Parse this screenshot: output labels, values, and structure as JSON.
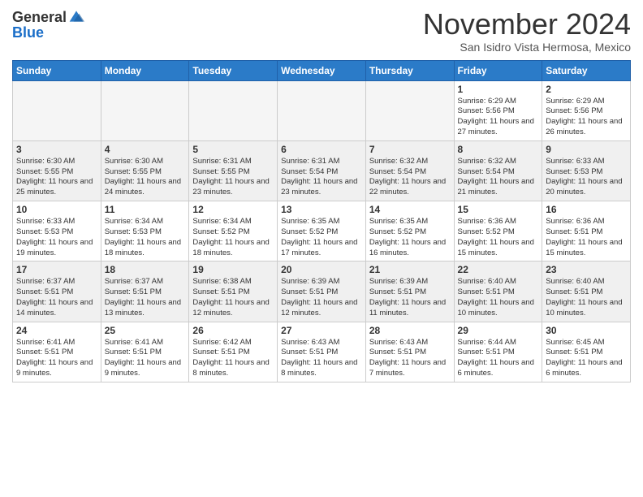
{
  "logo": {
    "general": "General",
    "blue": "Blue"
  },
  "header": {
    "month": "November 2024",
    "location": "San Isidro Vista Hermosa, Mexico"
  },
  "days_of_week": [
    "Sunday",
    "Monday",
    "Tuesday",
    "Wednesday",
    "Thursday",
    "Friday",
    "Saturday"
  ],
  "weeks": [
    [
      {
        "day": "",
        "empty": true
      },
      {
        "day": "",
        "empty": true
      },
      {
        "day": "",
        "empty": true
      },
      {
        "day": "",
        "empty": true
      },
      {
        "day": "",
        "empty": true
      },
      {
        "day": "1",
        "sunrise": "6:29 AM",
        "sunset": "5:56 PM",
        "daylight": "11 hours and 27 minutes."
      },
      {
        "day": "2",
        "sunrise": "6:29 AM",
        "sunset": "5:56 PM",
        "daylight": "11 hours and 26 minutes."
      }
    ],
    [
      {
        "day": "3",
        "sunrise": "6:30 AM",
        "sunset": "5:55 PM",
        "daylight": "11 hours and 25 minutes."
      },
      {
        "day": "4",
        "sunrise": "6:30 AM",
        "sunset": "5:55 PM",
        "daylight": "11 hours and 24 minutes."
      },
      {
        "day": "5",
        "sunrise": "6:31 AM",
        "sunset": "5:55 PM",
        "daylight": "11 hours and 23 minutes."
      },
      {
        "day": "6",
        "sunrise": "6:31 AM",
        "sunset": "5:54 PM",
        "daylight": "11 hours and 23 minutes."
      },
      {
        "day": "7",
        "sunrise": "6:32 AM",
        "sunset": "5:54 PM",
        "daylight": "11 hours and 22 minutes."
      },
      {
        "day": "8",
        "sunrise": "6:32 AM",
        "sunset": "5:54 PM",
        "daylight": "11 hours and 21 minutes."
      },
      {
        "day": "9",
        "sunrise": "6:33 AM",
        "sunset": "5:53 PM",
        "daylight": "11 hours and 20 minutes."
      }
    ],
    [
      {
        "day": "10",
        "sunrise": "6:33 AM",
        "sunset": "5:53 PM",
        "daylight": "11 hours and 19 minutes."
      },
      {
        "day": "11",
        "sunrise": "6:34 AM",
        "sunset": "5:53 PM",
        "daylight": "11 hours and 18 minutes."
      },
      {
        "day": "12",
        "sunrise": "6:34 AM",
        "sunset": "5:52 PM",
        "daylight": "11 hours and 18 minutes."
      },
      {
        "day": "13",
        "sunrise": "6:35 AM",
        "sunset": "5:52 PM",
        "daylight": "11 hours and 17 minutes."
      },
      {
        "day": "14",
        "sunrise": "6:35 AM",
        "sunset": "5:52 PM",
        "daylight": "11 hours and 16 minutes."
      },
      {
        "day": "15",
        "sunrise": "6:36 AM",
        "sunset": "5:52 PM",
        "daylight": "11 hours and 15 minutes."
      },
      {
        "day": "16",
        "sunrise": "6:36 AM",
        "sunset": "5:51 PM",
        "daylight": "11 hours and 15 minutes."
      }
    ],
    [
      {
        "day": "17",
        "sunrise": "6:37 AM",
        "sunset": "5:51 PM",
        "daylight": "11 hours and 14 minutes."
      },
      {
        "day": "18",
        "sunrise": "6:37 AM",
        "sunset": "5:51 PM",
        "daylight": "11 hours and 13 minutes."
      },
      {
        "day": "19",
        "sunrise": "6:38 AM",
        "sunset": "5:51 PM",
        "daylight": "11 hours and 12 minutes."
      },
      {
        "day": "20",
        "sunrise": "6:39 AM",
        "sunset": "5:51 PM",
        "daylight": "11 hours and 12 minutes."
      },
      {
        "day": "21",
        "sunrise": "6:39 AM",
        "sunset": "5:51 PM",
        "daylight": "11 hours and 11 minutes."
      },
      {
        "day": "22",
        "sunrise": "6:40 AM",
        "sunset": "5:51 PM",
        "daylight": "11 hours and 10 minutes."
      },
      {
        "day": "23",
        "sunrise": "6:40 AM",
        "sunset": "5:51 PM",
        "daylight": "11 hours and 10 minutes."
      }
    ],
    [
      {
        "day": "24",
        "sunrise": "6:41 AM",
        "sunset": "5:51 PM",
        "daylight": "11 hours and 9 minutes."
      },
      {
        "day": "25",
        "sunrise": "6:41 AM",
        "sunset": "5:51 PM",
        "daylight": "11 hours and 9 minutes."
      },
      {
        "day": "26",
        "sunrise": "6:42 AM",
        "sunset": "5:51 PM",
        "daylight": "11 hours and 8 minutes."
      },
      {
        "day": "27",
        "sunrise": "6:43 AM",
        "sunset": "5:51 PM",
        "daylight": "11 hours and 8 minutes."
      },
      {
        "day": "28",
        "sunrise": "6:43 AM",
        "sunset": "5:51 PM",
        "daylight": "11 hours and 7 minutes."
      },
      {
        "day": "29",
        "sunrise": "6:44 AM",
        "sunset": "5:51 PM",
        "daylight": "11 hours and 6 minutes."
      },
      {
        "day": "30",
        "sunrise": "6:45 AM",
        "sunset": "5:51 PM",
        "daylight": "11 hours and 6 minutes."
      }
    ]
  ]
}
